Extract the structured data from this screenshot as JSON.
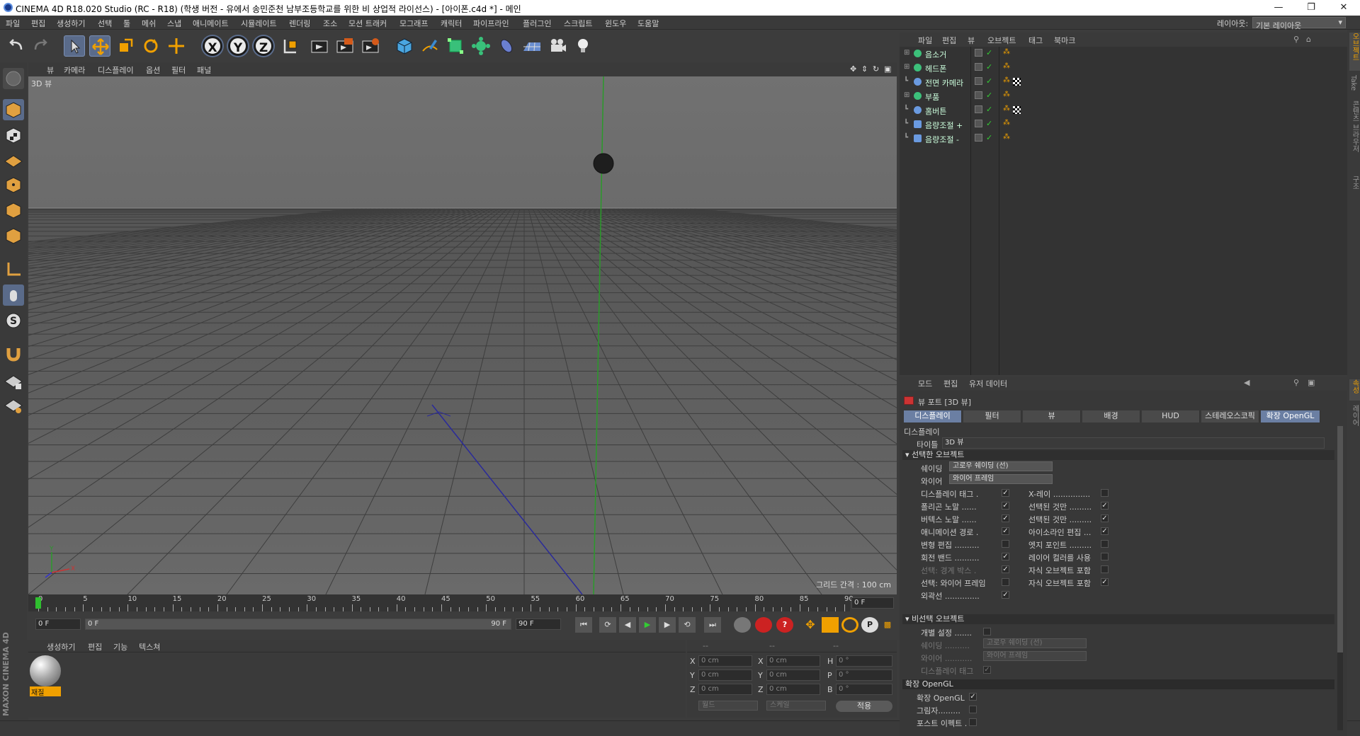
{
  "window": {
    "title": "CINEMA 4D R18.020 Studio (RC - R18) (학생 버전 - 유에서 송민준천 남부조등학교를 위한 비 상업적 라이선스) - [아이폰.c4d *] - 메인"
  },
  "menubar": {
    "items": [
      "파일",
      "편집",
      "생성하기",
      "선택",
      "툴",
      "메쉬",
      "스냅",
      "애니메이트",
      "시뮬레이트",
      "렌더링",
      "조소",
      "모션 트래커",
      "모그래프",
      "캐릭터",
      "파이프라인",
      "플러그인",
      "스크립트",
      "윈도우",
      "도움말"
    ],
    "layout_label": "레이아웃:",
    "layout_value": "기본 레이아웃"
  },
  "viewport": {
    "menu": [
      "뷰",
      "카메라",
      "디스플레이",
      "옵션",
      "필터",
      "패널"
    ],
    "label": "3D 뷰",
    "grid_spacing": "그리드 간격 : 100 cm"
  },
  "timeline": {
    "ticks": [
      "0",
      "5",
      "10",
      "15",
      "20",
      "25",
      "30",
      "35",
      "40",
      "45",
      "50",
      "55",
      "60",
      "65",
      "70",
      "75",
      "80",
      "85",
      "90"
    ],
    "current_frame": "0 F",
    "start_field": "0 F",
    "range_start": "0 F",
    "range_end": "90 F",
    "end_field": "90 F"
  },
  "material_panel": {
    "menu": [
      "생성하기",
      "편집",
      "기능",
      "텍스쳐"
    ],
    "material_name": "재질"
  },
  "coord_panel": {
    "headers": [
      "--",
      "--",
      "--"
    ],
    "rows": [
      {
        "a": "X",
        "av": "0 cm",
        "b": "X",
        "bv": "0 cm",
        "c": "H",
        "cv": "0 °"
      },
      {
        "a": "Y",
        "av": "0 cm",
        "b": "Y",
        "bv": "0 cm",
        "c": "P",
        "cv": "0 °"
      },
      {
        "a": "Z",
        "av": "0 cm",
        "b": "Z",
        "bv": "0 cm",
        "c": "B",
        "cv": "0 °"
      }
    ],
    "mode1": "월드",
    "mode2": "스케일",
    "apply": "적용"
  },
  "object_manager": {
    "menu": [
      "파일",
      "편집",
      "뷰",
      "오브젝트",
      "태그",
      "북마크"
    ],
    "objects": [
      {
        "name": "음소거",
        "icon": "null"
      },
      {
        "name": "헤드폰",
        "icon": "null"
      },
      {
        "name": "전면 카메라",
        "icon": "bone"
      },
      {
        "name": "부품",
        "icon": "null"
      },
      {
        "name": "홈버튼",
        "icon": "bone"
      },
      {
        "name": "음량조절 +",
        "icon": "cyl"
      },
      {
        "name": "음량조절 -",
        "icon": "cyl"
      }
    ]
  },
  "attribute_manager": {
    "menu": [
      "모드",
      "편집",
      "유저 데이터"
    ],
    "header": "뷰 포트 [3D 뷰]",
    "tabs": [
      "디스플레이",
      "필터",
      "뷰",
      "배경",
      "HUD",
      "스테레오스코픽",
      "확장 OpenGL"
    ],
    "section_display": "디스플레이",
    "title_label": "타이틀",
    "title_value": "3D 뷰",
    "selected_section": "선택한 오브젝트",
    "shading_label": "쉐이딩",
    "shading_value": "고로우 쉐이딩 (선)",
    "wire_label": "와이어",
    "wire_value": "와이어 프레임",
    "options_left": [
      {
        "label": "디스플레이 태그 .",
        "checked": "✓"
      },
      {
        "label": "폴리곤 노말 ......",
        "checked": "✓"
      },
      {
        "label": "버텍스 노말 ......",
        "checked": "✓"
      },
      {
        "label": "애니메이션 경로 .",
        "checked": "✓"
      },
      {
        "label": "변형 편집 ..........",
        "checked": ""
      },
      {
        "label": "회전 밴드 ..........",
        "checked": "✓"
      },
      {
        "label": "선택: 경계 박스 .",
        "checked": "✓"
      },
      {
        "label": "선택: 와이어 프레임",
        "checked": ""
      },
      {
        "label": "외곽선 ..............",
        "checked": "✓"
      }
    ],
    "options_right": [
      {
        "label": "X-레이 ...............",
        "checked": ""
      },
      {
        "label": "선택된 것만 .........",
        "checked": "✓"
      },
      {
        "label": "선택된 것만 .........",
        "checked": "✓"
      },
      {
        "label": "아이소라인 편집 ...",
        "checked": "✓"
      },
      {
        "label": "엣지 포인트 .........",
        "checked": ""
      },
      {
        "label": "레이어 컬러를 사용",
        "checked": ""
      },
      {
        "label": "자식 오브젝트 포함",
        "checked": ""
      },
      {
        "label": "자식 오브젝트 포함",
        "checked": "✓"
      }
    ],
    "unselected_section": "비선택 오브젝트",
    "individual_label": "개별 설정 .......",
    "u_shading_label": "쉐이딩 ..........",
    "u_shading_value": "고로우 쉐이딩 (선)",
    "u_wire_label": "와이어 ...........",
    "u_wire_value": "와이어 프레임",
    "u_tag_label": "디스플레이 태그",
    "u_tag_checked": "✓",
    "gl_section": "확장 OpenGL",
    "gl_label": "확장 OpenGL",
    "gl_checked": "✓",
    "shadow_label": "그림자.........",
    "post_label": "포스트 이펙트 ."
  },
  "right_strip": [
    "오브젝트",
    "Take",
    "콘텐츠 브라우저",
    "구조",
    "속성",
    "레이어"
  ],
  "maxon_logo": "MAXON CINEMA 4D"
}
